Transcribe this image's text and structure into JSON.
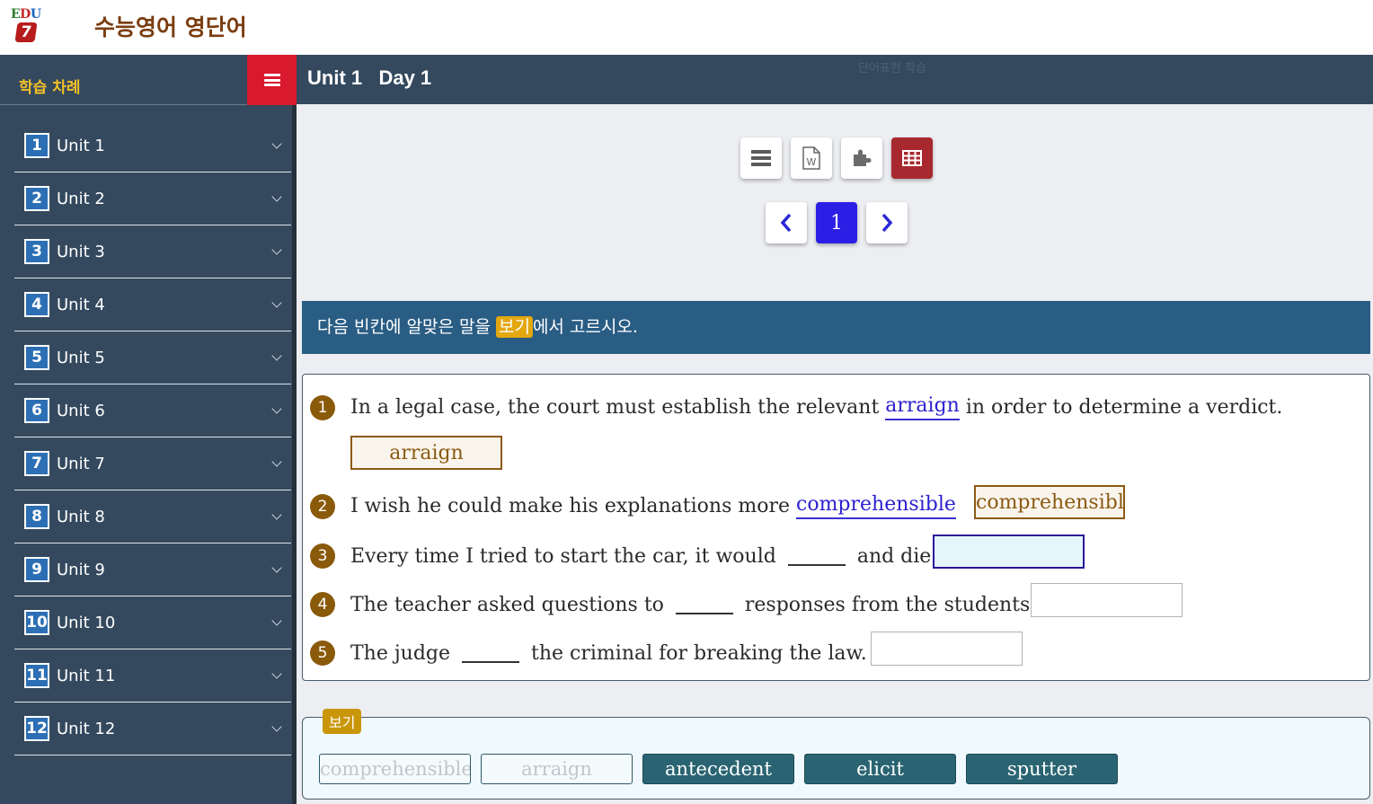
{
  "header": {
    "logo_text": "EDU",
    "logo_digit": "7",
    "app_title": "수능영어 영단어"
  },
  "sidebar": {
    "title": "학습 차례",
    "units": [
      {
        "num": "1",
        "label": "Unit 1"
      },
      {
        "num": "2",
        "label": "Unit 2"
      },
      {
        "num": "3",
        "label": "Unit 3"
      },
      {
        "num": "4",
        "label": "Unit 4"
      },
      {
        "num": "5",
        "label": "Unit 5"
      },
      {
        "num": "6",
        "label": "Unit 6"
      },
      {
        "num": "7",
        "label": "Unit 7"
      },
      {
        "num": "8",
        "label": "Unit 8"
      },
      {
        "num": "9",
        "label": "Unit 9"
      },
      {
        "num": "10",
        "label": "Unit 10"
      },
      {
        "num": "11",
        "label": "Unit 11"
      },
      {
        "num": "12",
        "label": "Unit 12"
      }
    ]
  },
  "content": {
    "title": "Unit 1   Day 1",
    "subtitle": "단어표현 학습"
  },
  "toolbar": {
    "icons": [
      "list-icon",
      "word-document-icon",
      "puzzle-icon",
      "table-icon"
    ],
    "active_index": 3
  },
  "pager": {
    "current_page": "1"
  },
  "instruction": {
    "before": "다음 빈칸에 알맞은 말을 ",
    "tag": "보기",
    "after": "에서 고르시오."
  },
  "questions": [
    {
      "num": "1",
      "before": "In a legal case, the court must establish the relevant ",
      "filled": "arraign",
      "after": " in order to determine a verdict.",
      "answer": "arraign"
    },
    {
      "num": "2",
      "before": "I wish he could make his explanations more ",
      "filled": "comprehensible",
      "after": "",
      "answer": "comprehensibl"
    },
    {
      "num": "3",
      "before": "Every time I tried to start the car, it would ",
      "after": " and die.",
      "answer": ""
    },
    {
      "num": "4",
      "before": "The teacher asked questions to ",
      "after": " responses from the students.",
      "answer": ""
    },
    {
      "num": "5",
      "before": "The judge ",
      "after": " the criminal for breaking the law.",
      "answer": ""
    }
  ],
  "word_bank": {
    "label": "보기",
    "words": [
      {
        "text": "comprehensible",
        "used": true
      },
      {
        "text": "arraign",
        "used": true
      },
      {
        "text": "antecedent",
        "used": false
      },
      {
        "text": "elicit",
        "used": false
      },
      {
        "text": "sputter",
        "used": false
      }
    ]
  },
  "colors": {
    "sidebar_bg": "#34495e",
    "menu_button": "#d8192e",
    "instruction_bg": "#2a5d84",
    "active_tool": "#a7282e",
    "page_button": "#2b1fe6",
    "question_number": "#8a5a0b",
    "word_chip": "#2a6472"
  }
}
